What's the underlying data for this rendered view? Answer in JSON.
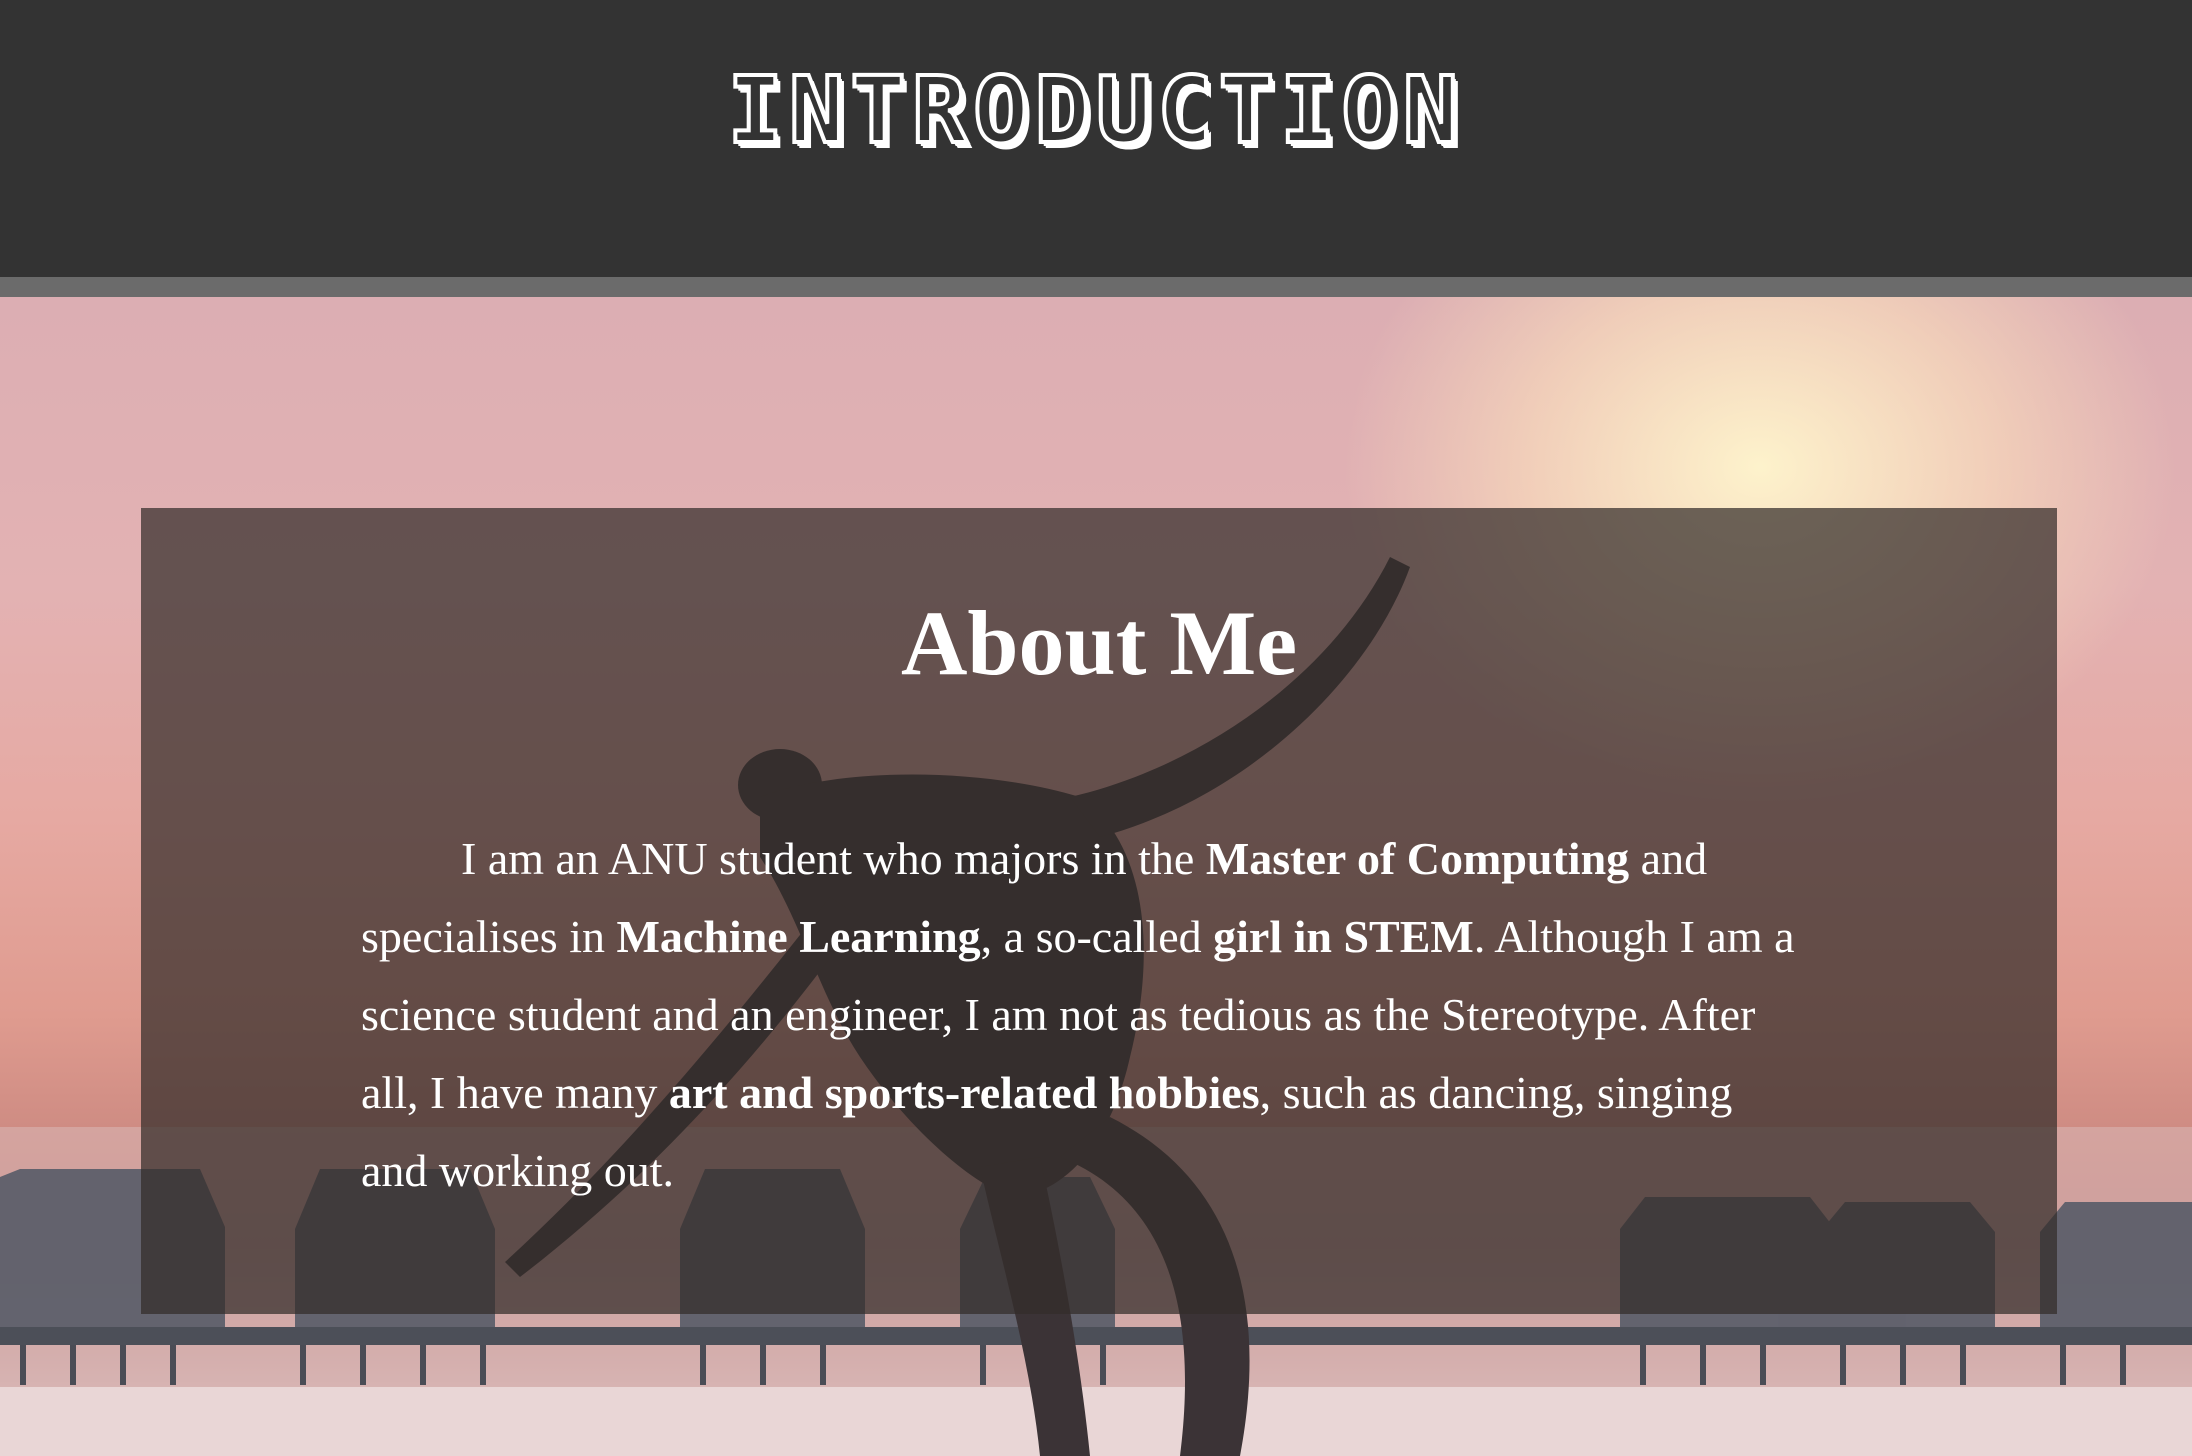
{
  "header": {
    "title": "INTRODUCTION"
  },
  "about": {
    "heading": "About Me",
    "paragraph": [
      {
        "text": "I am an ANU student who majors in the ",
        "bold": false
      },
      {
        "text": "Master of Computing",
        "bold": true
      },
      {
        "text": " and specialises in ",
        "bold": false
      },
      {
        "text": "Machine Learning",
        "bold": true
      },
      {
        "text": ", a so-called ",
        "bold": false
      },
      {
        "text": "girl in STEM",
        "bold": true
      },
      {
        "text": ". Although I am a science student and an engineer, I am not as tedious as the Stereotype. After all, I have many ",
        "bold": false
      },
      {
        "text": "art and sports-related hobbies",
        "bold": true
      },
      {
        "text": ", such as dancing, singing and working out.",
        "bold": false
      }
    ]
  },
  "colors": {
    "header_bg": "#333333",
    "header_rule": "#6b6b6b",
    "panel_bg": "rgba(51,44,42,0.72)",
    "text": "#ffffff"
  },
  "background_image": "sunset beach with overwater bungalows and a dancer"
}
